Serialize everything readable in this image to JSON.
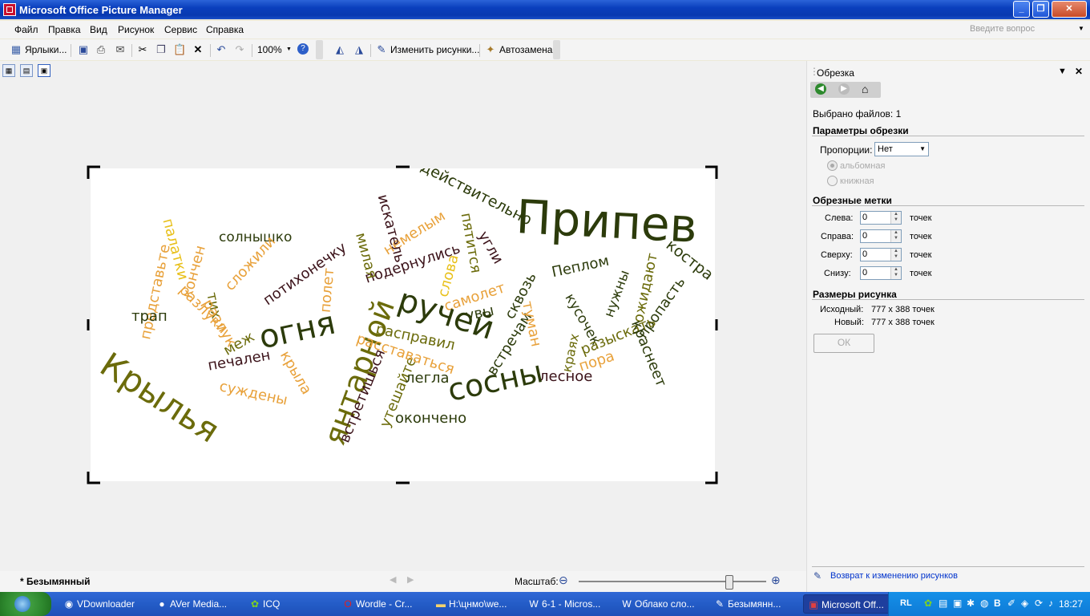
{
  "window": {
    "title": "Microsoft Office Picture Manager",
    "min": "_",
    "restore": "❐",
    "close": "✕"
  },
  "menu": [
    "Файл",
    "Правка",
    "Вид",
    "Рисунок",
    "Сервис",
    "Справка"
  ],
  "help_placeholder": "Введите вопрос",
  "toolbar": {
    "shortcuts": "Ярлыки...",
    "zoom": "100%",
    "edit_pictures": "Изменить рисунки...",
    "autocorrect": "Автозамена"
  },
  "wordcloud": [
    "Припев",
    "действительно",
    "костра",
    "Пеплом",
    "ожидают",
    "пропасть",
    "нужны",
    "кусочек",
    "краях",
    "разыскать",
    "краснеет",
    "пора",
    "лесное",
    "сосны",
    "встречам",
    "туман",
    "сквозь",
    "увы",
    "самолет",
    "ручей",
    "слова",
    "пятится",
    "угли",
    "немелым",
    "подернулись",
    "искатель",
    "милая",
    "полет",
    "потихонечку",
    "солнышко",
    "сложили",
    "тих",
    "разлук",
    "разлуки",
    "кончен",
    "палатки",
    "представьте",
    "трап",
    "Крылья",
    "огня",
    "янтарной",
    "меж",
    "печален",
    "крыла",
    "суждены",
    "встретишься",
    "утешайте",
    "окончено",
    "легла",
    "расставаться",
    "расправил"
  ],
  "taskpane": {
    "title": "Обрезка",
    "files_selected": "Выбрано файлов: 1",
    "crop_params": "Параметры обрезки",
    "proportions_label": "Пропорции:",
    "proportions_value": "Нет",
    "landscape": "альбомная",
    "portrait": "книжная",
    "crop_marks": "Обрезные метки",
    "fields": [
      {
        "label": "Слева:",
        "value": "0",
        "unit": "точек"
      },
      {
        "label": "Справа:",
        "value": "0",
        "unit": "точек"
      },
      {
        "label": "Сверху:",
        "value": "0",
        "unit": "точек"
      },
      {
        "label": "Снизу:",
        "value": "0",
        "unit": "точек"
      }
    ],
    "sizes": "Размеры рисунка",
    "original_label": "Исходный:",
    "original_value": "777 x 388 точек",
    "new_label": "Новый:",
    "new_value": "777 x 388 точек",
    "ok": "ОК",
    "back_link": "Возврат к изменению рисунков"
  },
  "status": {
    "filename": "* Безымянный",
    "zoom_label": "Масштаб:",
    "zoom_level": 0.8
  },
  "taskbar": {
    "items": [
      "VDownloader",
      "AVer Media...",
      "ICQ",
      "Wordle - Cr...",
      "H:\\цнмо\\we...",
      "6-1 - Micros...",
      "Облако сло...",
      "Безымянн...",
      "Microsoft Off..."
    ],
    "lang": "RL",
    "clock": "18:27"
  },
  "colors": {
    "titlebar": "#0a3fbd",
    "taskbar": "#245cc7",
    "link": "#0033cc"
  }
}
